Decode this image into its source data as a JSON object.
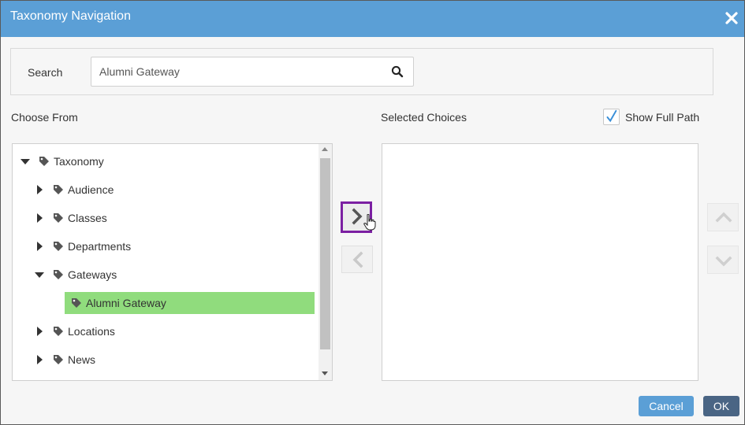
{
  "dialog": {
    "title": "Taxonomy Navigation",
    "close_icon": "close-icon",
    "colors": {
      "titlebar": "#5b9fd6",
      "selected_row": "#90dc7d",
      "cancel": "#5b9fd6",
      "ok": "#4a6584",
      "focus_border": "#7b1fa2"
    }
  },
  "search": {
    "label": "Search",
    "value": "Alumni Gateway",
    "icon": "search-icon"
  },
  "choose_from": {
    "label": "Choose From",
    "tree": [
      {
        "label": "Taxonomy",
        "state": "expanded",
        "level": 0
      },
      {
        "label": "Audience",
        "state": "collapsed",
        "level": 1
      },
      {
        "label": "Classes",
        "state": "collapsed",
        "level": 1
      },
      {
        "label": "Departments",
        "state": "collapsed",
        "level": 1
      },
      {
        "label": "Gateways",
        "state": "expanded",
        "level": 1
      },
      {
        "label": "Alumni Gateway",
        "state": "leaf",
        "level": 2,
        "selected": true
      },
      {
        "label": "Locations",
        "state": "collapsed",
        "level": 1
      },
      {
        "label": "News",
        "state": "collapsed",
        "level": 1
      }
    ]
  },
  "selected_choices": {
    "label": "Selected Choices",
    "show_full_path": {
      "label": "Show Full Path",
      "checked": true
    }
  },
  "buttons": {
    "add_icon": "chevron-right-icon",
    "remove_icon": "chevron-left-icon",
    "move_up_icon": "chevron-up-icon",
    "move_down_icon": "chevron-down-icon",
    "cancel": "Cancel",
    "ok": "OK"
  }
}
